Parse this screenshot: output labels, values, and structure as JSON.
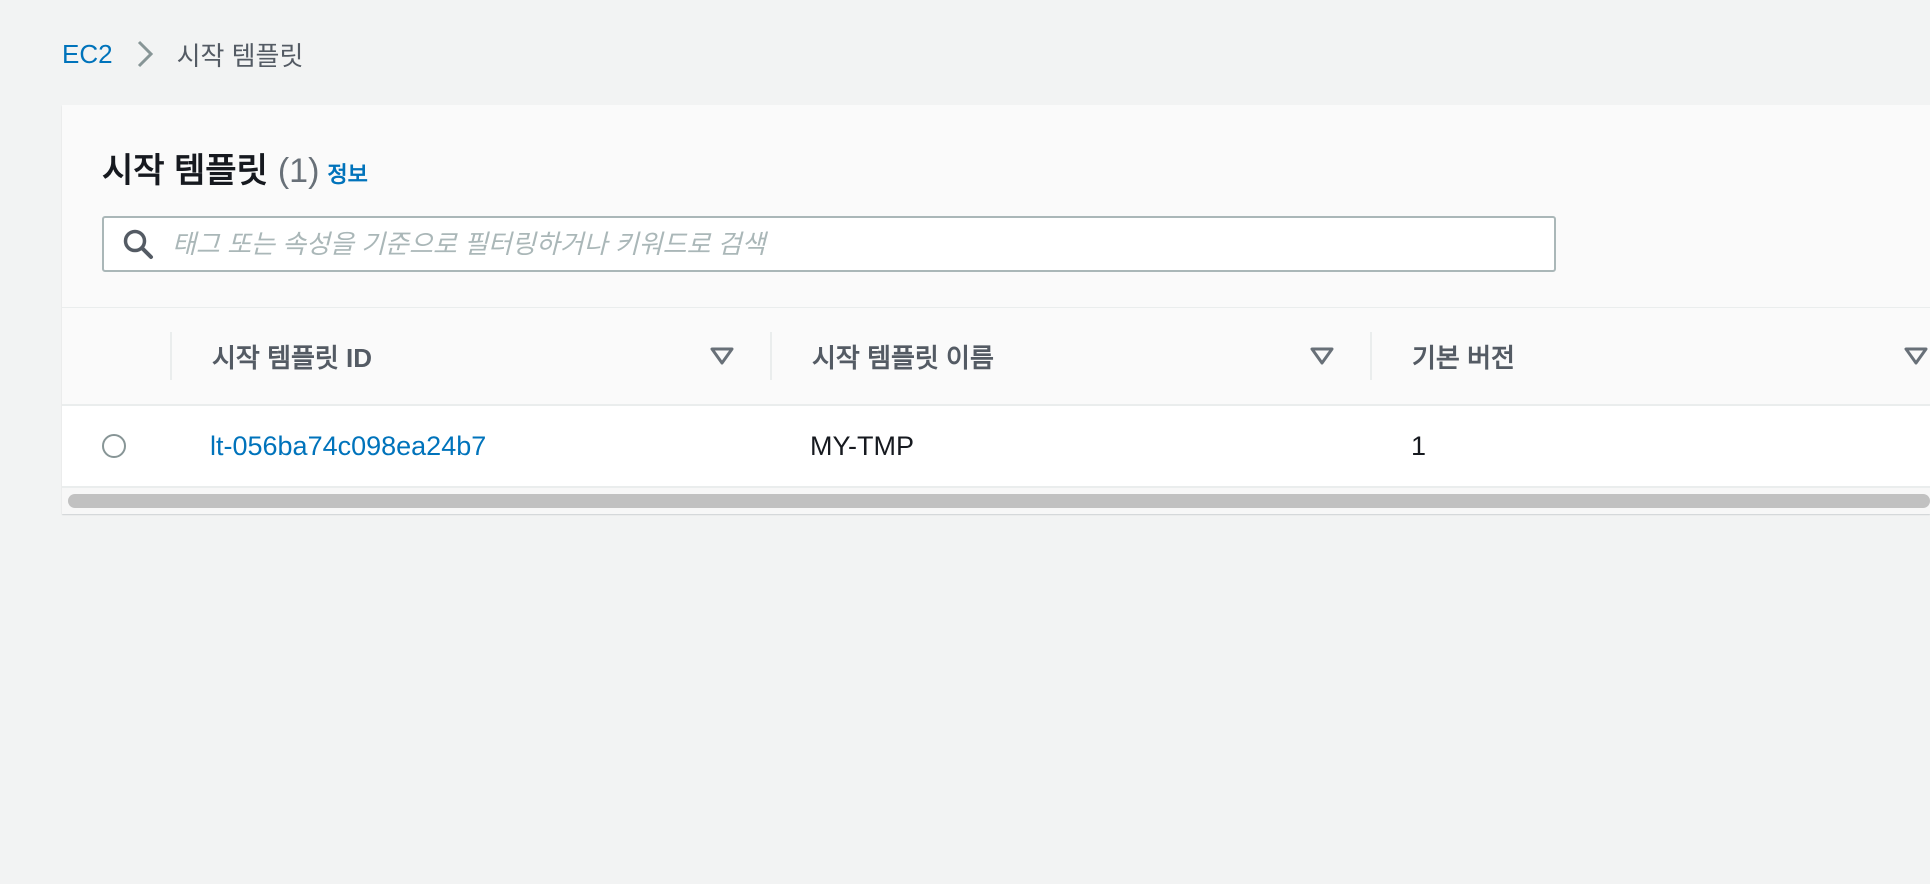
{
  "breadcrumb": {
    "root": "EC2",
    "current": "시작 템플릿"
  },
  "header": {
    "title": "시작 템플릿",
    "count": "(1)",
    "info": "정보"
  },
  "search": {
    "placeholder": "태그 또는 속성을 기준으로 필터링하거나 키워드로 검색",
    "value": ""
  },
  "table": {
    "columns": [
      "시작 템플릿 ID",
      "시작 템플릿 이름",
      "기본 버전"
    ],
    "rows": [
      {
        "selected": false,
        "id": "lt-056ba74c098ea24b7",
        "name": "MY-TMP",
        "default_version": "1"
      }
    ]
  },
  "colors": {
    "link": "#0073bb",
    "page_background": "#f2f3f3",
    "text": "#16191f",
    "muted_text": "#545b64"
  },
  "icons": {
    "breadcrumb_separator": "chevron-right-icon",
    "search": "search-icon",
    "sort": "sort-caret-down-icon",
    "row_select": "radio-button"
  }
}
